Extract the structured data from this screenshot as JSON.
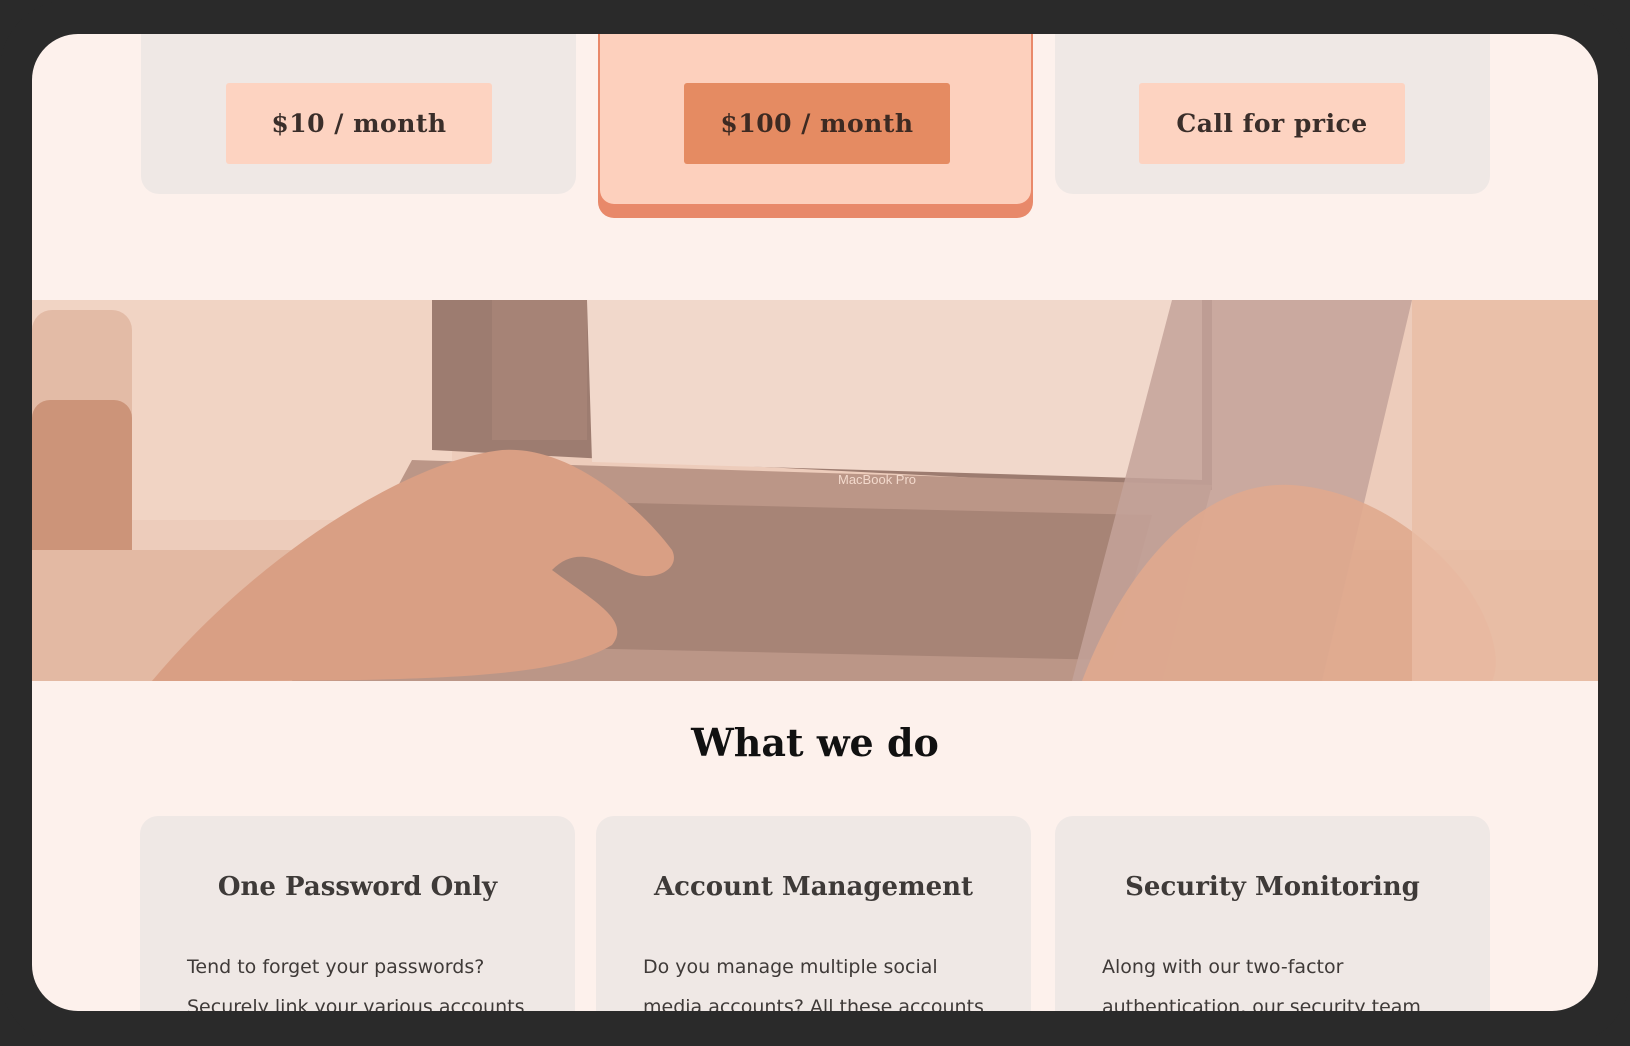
{
  "pricing": {
    "plans": [
      {
        "button_label": "$10 / month"
      },
      {
        "button_label": "$100 / month"
      },
      {
        "button_label": "Call for price"
      }
    ]
  },
  "hero": {
    "laptop_label": "MacBook Pro"
  },
  "what_we_do": {
    "title": "What we do",
    "features": [
      {
        "title": "One Password Only",
        "text": "Tend to forget your passwords? Securely link your various accounts"
      },
      {
        "title": "Account Management",
        "text": "Do you manage multiple social media accounts? All these accounts are"
      },
      {
        "title": "Security Monitoring",
        "text": "Along with our two-factor authentication, our security team"
      }
    ]
  },
  "colors": {
    "accent": "#e58b62",
    "accent_light": "#fdd3c1",
    "card_bg": "#efe8e5",
    "page_bg": "#fdf1ec"
  }
}
